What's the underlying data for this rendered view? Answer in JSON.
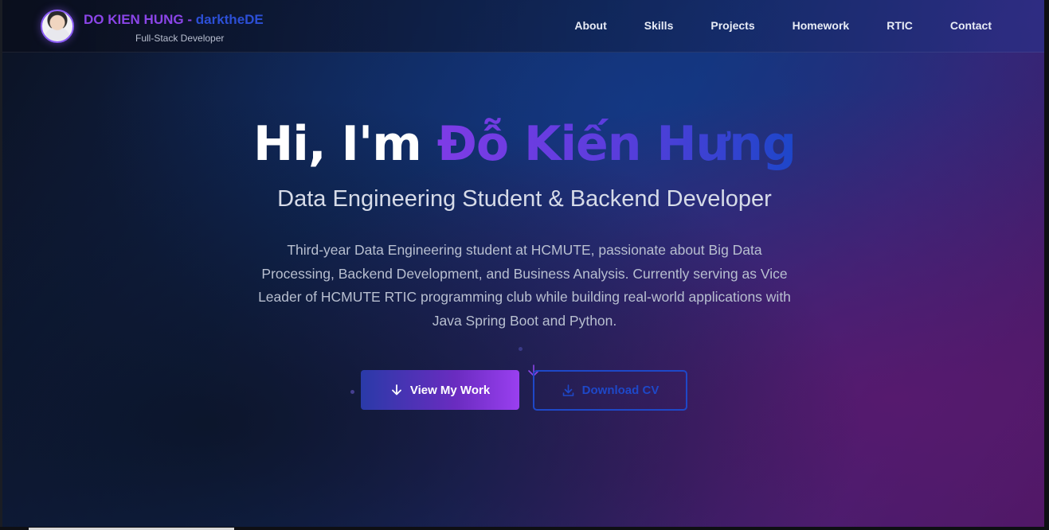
{
  "header": {
    "brand_name": "DO KIEN HUNG",
    "brand_separator": " - ",
    "brand_handle": "darktheDE",
    "brand_subtitle": "Full-Stack Developer"
  },
  "nav": {
    "items": [
      {
        "label": "About"
      },
      {
        "label": "Skills"
      },
      {
        "label": "Projects"
      },
      {
        "label": "Homework"
      },
      {
        "label": "RTIC"
      },
      {
        "label": "Contact"
      }
    ]
  },
  "hero": {
    "greeting": "Hi, I'm ",
    "name": "Đỗ Kiến Hưng",
    "role": "Data Engineering Student & Backend Developer",
    "description": "Third-year Data Engineering student at HCMUTE, passionate about Big Data Processing, Backend Development, and Business Analysis. Currently serving as Vice Leader of HCMUTE RTIC programming club while building real-world applications with Java Spring Boot and Python.",
    "primary_button": "View My Work",
    "secondary_button": "Download CV"
  },
  "icons": {
    "primary_button_icon": "arrow-down-icon",
    "secondary_button_icon": "download-icon",
    "scroll_indicator": "chevron-down-arrow-icon"
  },
  "colors": {
    "accent_purple": "#8b45e8",
    "accent_blue": "#1e48c8"
  }
}
